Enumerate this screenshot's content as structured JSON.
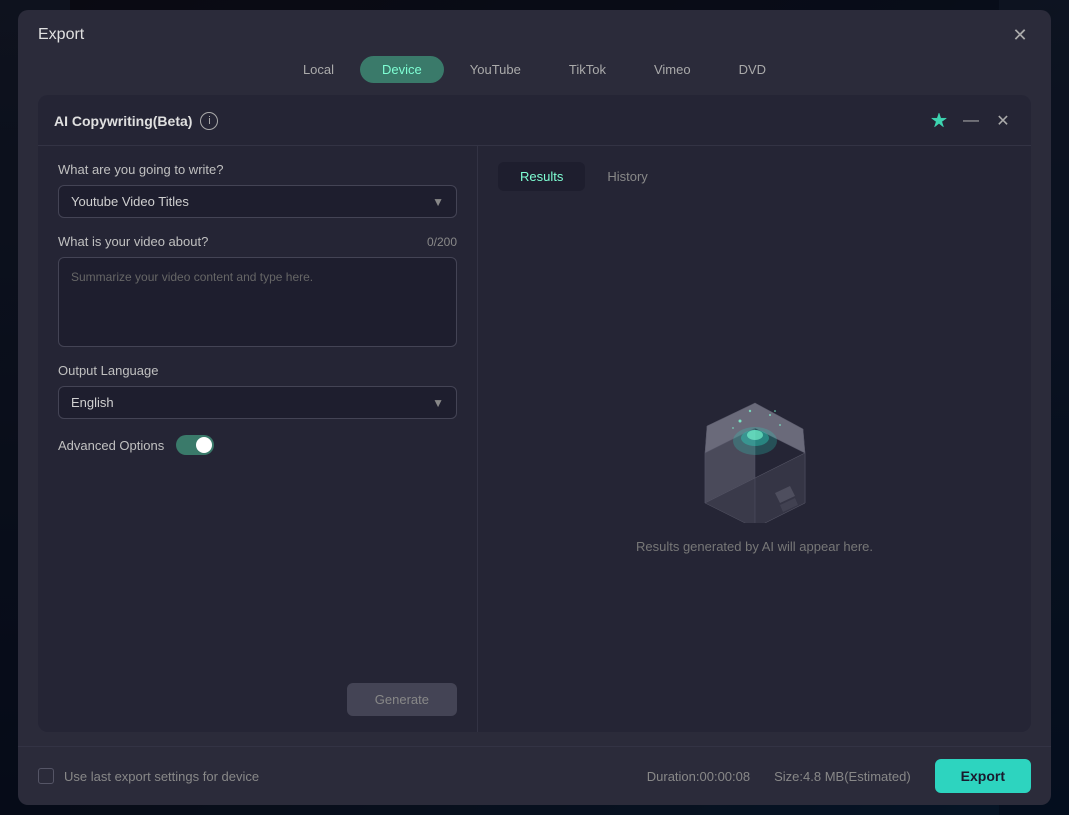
{
  "modal": {
    "title": "Export",
    "close_label": "✕"
  },
  "tabs": {
    "items": [
      {
        "label": "Local",
        "active": false
      },
      {
        "label": "Device",
        "active": true
      },
      {
        "label": "YouTube",
        "active": false
      },
      {
        "label": "TikTok",
        "active": false
      },
      {
        "label": "Vimeo",
        "active": false
      },
      {
        "label": "DVD",
        "active": false
      }
    ]
  },
  "ai_panel": {
    "title": "AI Copywriting(Beta)",
    "info_icon": "i",
    "pin_icon": "📌",
    "minimize_icon": "—",
    "close_icon": "✕"
  },
  "results_tabs": [
    {
      "label": "Results",
      "active": true
    },
    {
      "label": "History",
      "active": false
    }
  ],
  "form": {
    "write_label": "What are you going to write?",
    "write_value": "Youtube Video Titles",
    "write_placeholder": "Youtube Video Titles",
    "video_label": "What is your video about?",
    "video_counter": "0/200",
    "video_placeholder": "Summarize your video content and type here.",
    "language_label": "Output Language",
    "language_value": "English",
    "advanced_label": "Advanced Options",
    "generate_btn": "Generate"
  },
  "results": {
    "empty_text": "Results generated by AI will appear here."
  },
  "footer": {
    "checkbox_label": "Use last export settings for device",
    "duration": "Duration:00:00:08",
    "size": "Size:4.8 MB(Estimated)",
    "export_btn": "Export"
  }
}
